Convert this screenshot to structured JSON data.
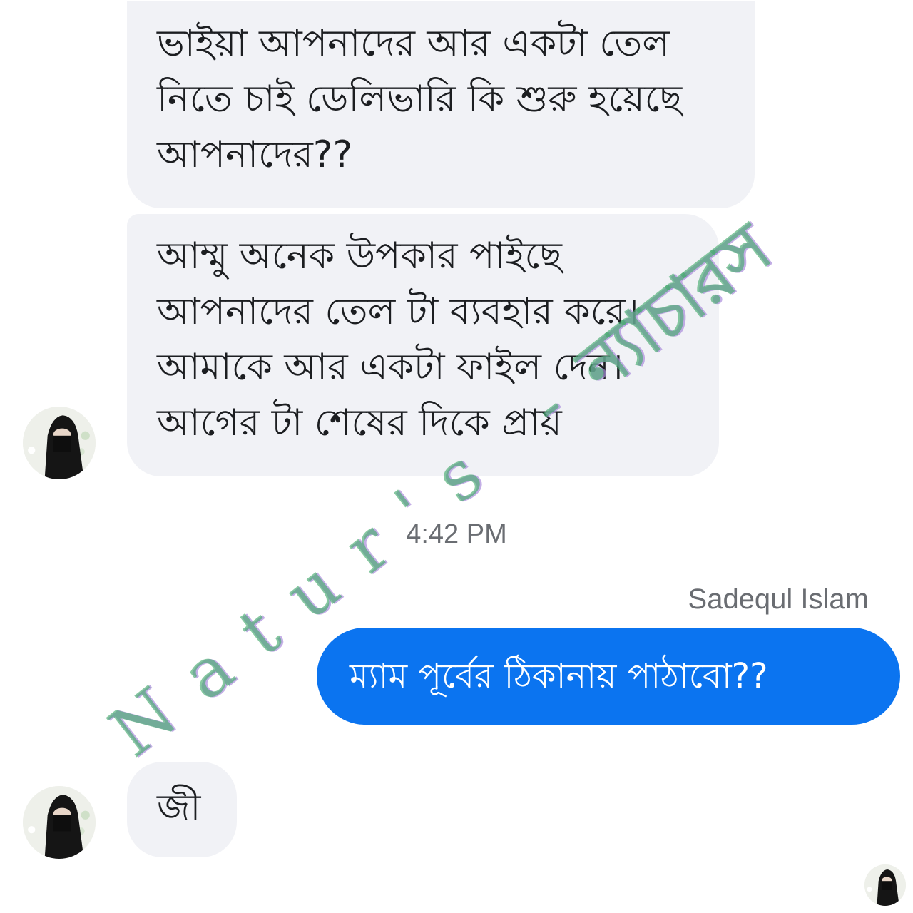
{
  "messages": {
    "incoming_1": "ভাইয়া আপনাদের আর একটা তেল\nনিতে চাই ডেলিভারি কি শুরু হয়েছে\nআপনাদের??",
    "incoming_2": "আম্মু অনেক উপকার পাইছে\nআপনাদের তেল টা ব্যবহার করে।\nআমাকে আর একটা ফাইল দেন।\nআগের টা শেষের দিকে প্রায়",
    "outgoing_1": "ম্যাম  পূর্বের ঠিকানায় পাঠাবো??",
    "incoming_3": "জী"
  },
  "timestamp": "4:42 PM",
  "sender_name": "Sadequl Islam",
  "watermark": {
    "latin": "Natur's -",
    "bangla": "ন্যাচারস"
  },
  "colors": {
    "incoming_bubble": "#f1f2f6",
    "outgoing_bubble": "#0b74f0",
    "meta_text": "#6a6d72",
    "watermark": "#46aa6e"
  },
  "icons": {
    "avatar": "contact-avatar"
  }
}
